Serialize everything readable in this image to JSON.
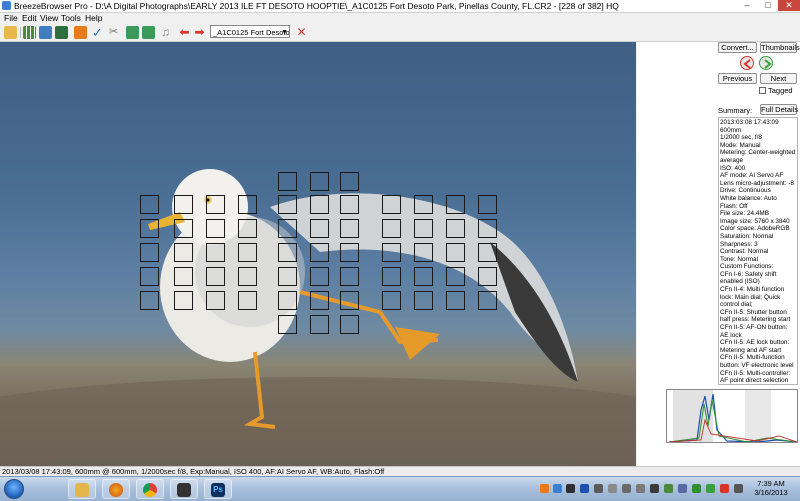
{
  "window": {
    "title": "BreezeBrowser Pro - D:\\A Digital Photographs\\EARLY 2013 ILE FT DESOTO HOOPTIE\\_A1C0125 Fort Desoto Park, Pinellas County, FL.CR2 - [228 of 382] HQ",
    "minimize_label": "–",
    "maximize_label": "□",
    "close_label": "✕"
  },
  "menu": [
    "File",
    "Edit",
    "View",
    "Tools",
    "Help"
  ],
  "toolbar": {
    "file_dropdown": "_A1C0125 Fort Desoto",
    "icons": [
      "open-folder-icon",
      "thumbnails-icon",
      "grid-view-icon",
      "slideshow-icon",
      "html-icon",
      "tag-check-icon",
      "delete-tool-icon",
      "rotate-left-icon",
      "rotate-right-icon",
      "music-icon",
      "previous-arrow-icon",
      "next-arrow-icon",
      "close-file-icon"
    ]
  },
  "side_panel": {
    "convert_label": "Convert...",
    "thumbnails_label": "Thumbnails",
    "previous_label": "Previous",
    "next_label": "Next",
    "tagged_label": "Tagged",
    "summary_label": "Summary:",
    "full_details_label": "Full Details",
    "info_lines": [
      "2013:03:08 17:43:09",
      "600mm",
      "1/2000 sec, f/8",
      "Mode: Manual",
      "Metering: Center-weighted average",
      "ISO: 400",
      "AF mode: AI Servo AF",
      "Lens micro-adjustment: -8",
      "Drive: Continuous",
      "White balance: Auto",
      "Flash: Off",
      "File size: 24.4MB",
      "Image size: 5760 x 3840",
      "Color space: AdobeRGB",
      "Saturation: Normal",
      "Sharpness: 3",
      "Contrast: Normal",
      "Tone: Normal",
      "Custom Functions:",
      "CFn I-6: Safety shift enabled (ISO)",
      "CFn II-4: Multi function lock: Main dial; Quick control dial;",
      "CFn II-5: Shutter button half press: Metering start",
      "CFn II-5: AF-ON button: AE lock",
      "CFn II-5: AE lock button: Metering and AF start",
      "CFn II-5: Multi-function button: VF electronic level",
      "CFn II-5: Multi-controller: AF point direct selection"
    ]
  },
  "status": {
    "text": "2013/03/08 17:43:09, 600mm @ 600mm, 1/2000sec f/8, Exp:Manual, ISO 400, AF:AI Servo AF, WB:Auto, Flash:Off"
  },
  "taskbar": {
    "apps": [
      "file-explorer-icon",
      "firefox-icon",
      "chrome-icon",
      "camera-app-icon",
      "photoshop-icon"
    ],
    "photoshop_label": "Ps",
    "time": "7:39 AM",
    "date": "3/16/2013"
  },
  "colors": {
    "accent_red": "#d8352a",
    "accent_green": "#3aa13a",
    "af_point_border": "#1a1a1a"
  }
}
